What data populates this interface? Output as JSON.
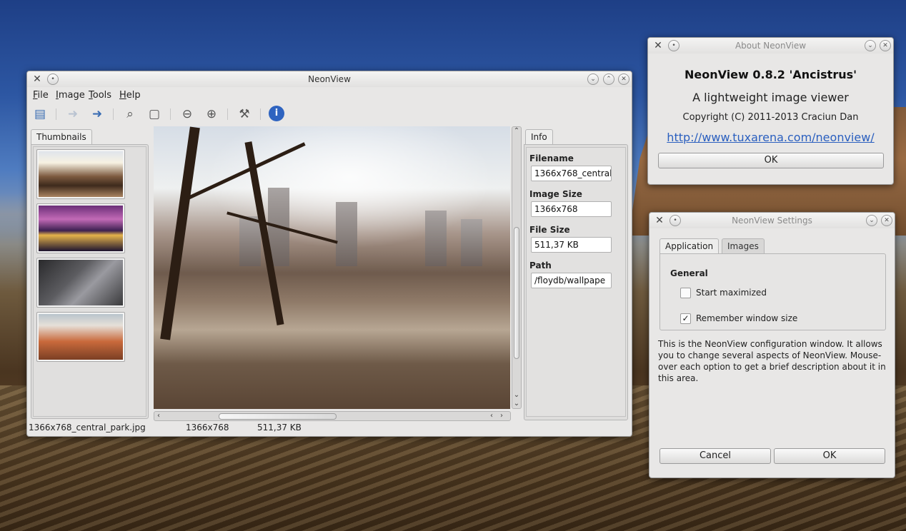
{
  "main_window": {
    "title": "NeonView",
    "menu": [
      {
        "label": "File",
        "accel": "F",
        "rest": "ile"
      },
      {
        "label": "Image",
        "accel": "I",
        "rest": "mage"
      },
      {
        "label": "Tools",
        "accel": "T",
        "rest": "ools"
      },
      {
        "label": "Help",
        "accel": "H",
        "rest": "elp"
      }
    ],
    "toolbar_icons": [
      "print-icon",
      "back-arrow-icon",
      "forward-arrow-icon",
      "zoom-original-icon",
      "fit-page-icon",
      "zoom-out-icon",
      "zoom-in-icon",
      "settings-tools-icon",
      "info-icon"
    ],
    "thumbnails_tab": "Thumbnails",
    "info_tab": "Info",
    "info": {
      "filename_label": "Filename",
      "filename": "1366x768_central",
      "image_size_label": "Image Size",
      "image_size": "1366x768",
      "file_size_label": "File Size",
      "file_size": "511,37 KB",
      "path_label": "Path",
      "path": "/floydb/wallpape"
    },
    "status": {
      "file": "1366x768_central_park.jpg",
      "dimensions": "1366x768",
      "size": "511,37 KB"
    }
  },
  "about_window": {
    "title": "About NeonView",
    "heading": "NeonView 0.8.2 'Ancistrus'",
    "subtitle": "A lightweight image viewer",
    "copyright": "Copyright (C) 2011-2013 Craciun Dan",
    "link": "http://www.tuxarena.com/neonview/",
    "ok_label": "OK"
  },
  "settings_window": {
    "title": "NeonView Settings",
    "tabs": [
      "Application",
      "Images"
    ],
    "group": "General",
    "options": [
      {
        "label": "Start maximized",
        "checked": false
      },
      {
        "label": "Remember window size",
        "checked": true
      }
    ],
    "description": "This is the NeonView configuration window. It allows you to change several aspects of NeonView. Mouse-over each option to get a brief description about it in this area.",
    "cancel_label": "Cancel",
    "ok_label": "OK"
  }
}
